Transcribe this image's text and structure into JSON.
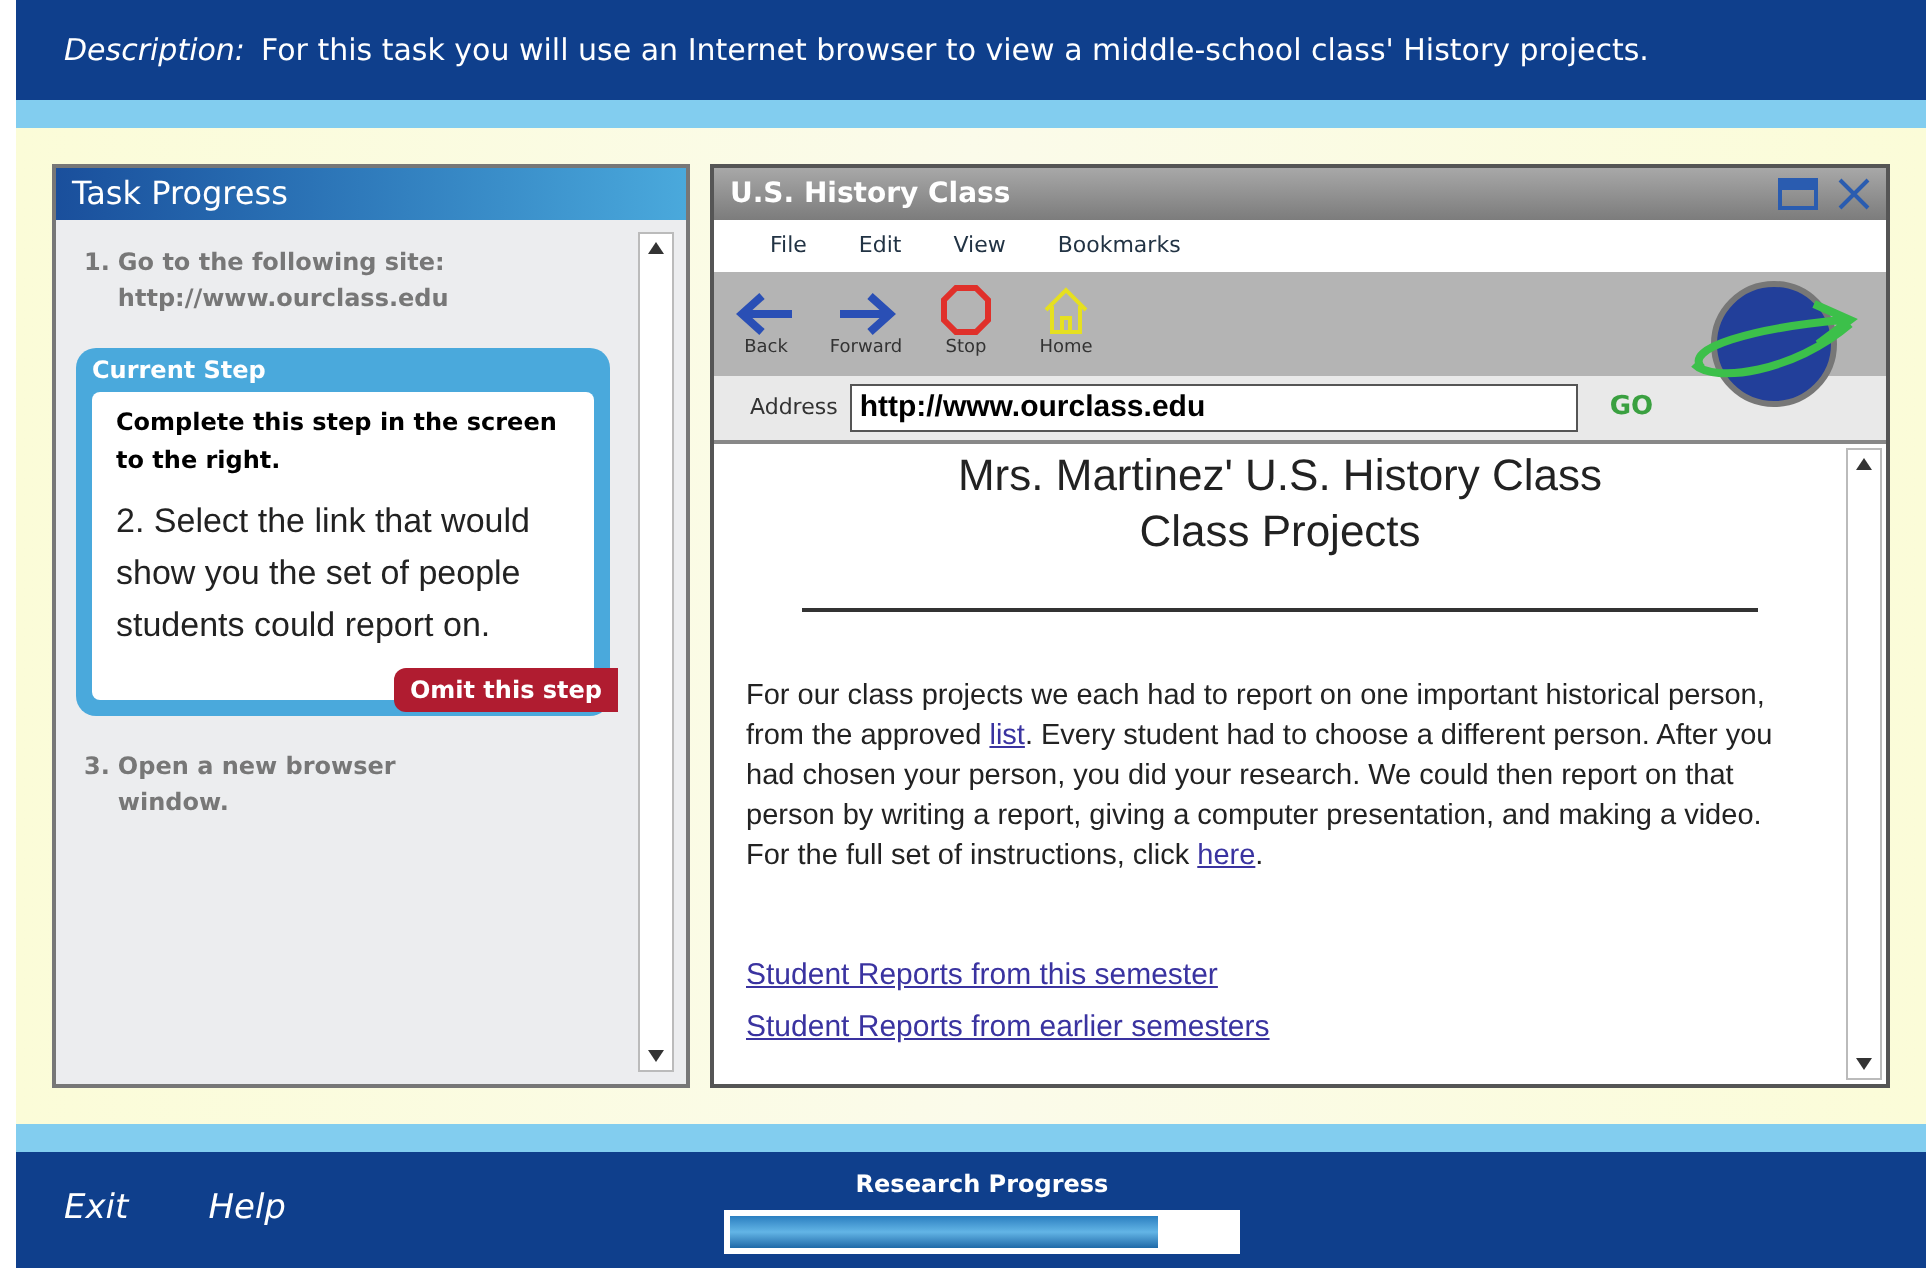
{
  "header": {
    "label": "Description:",
    "text": "For this task you will use an Internet browser to view a middle-school class' History projects."
  },
  "task_panel": {
    "title": "Task Progress",
    "steps": [
      {
        "kind": "step",
        "number": "1.",
        "lines": [
          "Go to the following site:",
          "http://www.ourclass.edu"
        ]
      },
      {
        "kind": "current",
        "label": "Current Step",
        "note": "Complete this step in the screen to the right.",
        "text": "2. Select the link that would show you the set of people students could report on.",
        "omit_button": "Omit this step"
      },
      {
        "kind": "step",
        "number": "3.",
        "lines": [
          "Open a new browser",
          "window."
        ]
      }
    ]
  },
  "browser": {
    "title": "U.S. History Class",
    "menu": [
      "File",
      "Edit",
      "View",
      "Bookmarks"
    ],
    "toolbar": [
      {
        "kind": "back",
        "label": "Back"
      },
      {
        "kind": "forward",
        "label": "Forward"
      },
      {
        "kind": "stop",
        "label": "Stop"
      },
      {
        "kind": "home",
        "label": "Home"
      }
    ],
    "address_label": "Address",
    "address": "http://www.ourclass.edu",
    "go": "GO",
    "page": {
      "heading": [
        "Mrs. Martinez' U.S. History Class",
        "Class Projects"
      ],
      "paragraphs": [
        [
          {
            "kind": "text",
            "text": "For our class projects we each had to report on one important historical person, from the approved "
          },
          {
            "kind": "link",
            "text": "list"
          },
          {
            "kind": "text",
            "text": ".  Every student had to choose a different person.  After you had chosen your person, you did your research.  We could then report on that person by writing a report, giving a computer presentation, and making a video."
          }
        ],
        [
          {
            "kind": "text",
            "text": "For the full set of instructions, click "
          },
          {
            "kind": "link",
            "text": "here"
          },
          {
            "kind": "text",
            "text": "."
          }
        ]
      ],
      "links": [
        "Student Reports from this semester",
        "Student Reports from earlier semesters"
      ]
    }
  },
  "footer": {
    "buttons": [
      "Exit",
      "Help"
    ],
    "progress_label": "Research Progress",
    "level": 0.85
  }
}
